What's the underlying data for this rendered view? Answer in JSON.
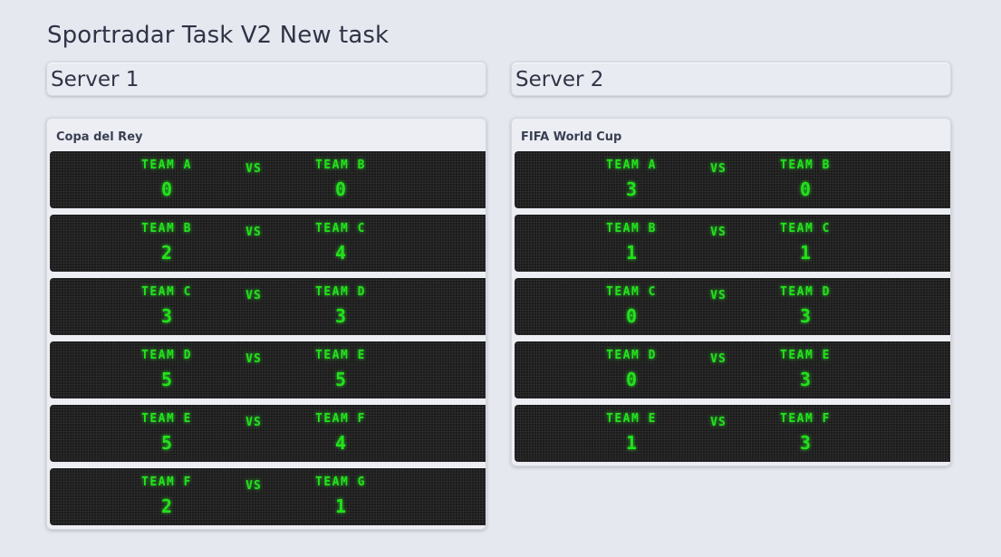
{
  "page_title": "Sportradar Task V2 New task",
  "vs_label": "VS",
  "servers": [
    {
      "name": "Server 1",
      "tournament": "Copa del Rey",
      "matches": [
        {
          "home": "TEAM A",
          "away": "TEAM B",
          "home_score": "0",
          "away_score": "0"
        },
        {
          "home": "TEAM B",
          "away": "TEAM C",
          "home_score": "2",
          "away_score": "4"
        },
        {
          "home": "TEAM C",
          "away": "TEAM D",
          "home_score": "3",
          "away_score": "3"
        },
        {
          "home": "TEAM D",
          "away": "TEAM E",
          "home_score": "5",
          "away_score": "5"
        },
        {
          "home": "TEAM E",
          "away": "TEAM F",
          "home_score": "5",
          "away_score": "4"
        },
        {
          "home": "TEAM F",
          "away": "TEAM G",
          "home_score": "2",
          "away_score": "1"
        }
      ]
    },
    {
      "name": "Server 2",
      "tournament": "FIFA World Cup",
      "matches": [
        {
          "home": "TEAM A",
          "away": "TEAM B",
          "home_score": "3",
          "away_score": "0"
        },
        {
          "home": "TEAM B",
          "away": "TEAM C",
          "home_score": "1",
          "away_score": "1"
        },
        {
          "home": "TEAM C",
          "away": "TEAM D",
          "home_score": "0",
          "away_score": "3"
        },
        {
          "home": "TEAM D",
          "away": "TEAM E",
          "home_score": "0",
          "away_score": "3"
        },
        {
          "home": "TEAM E",
          "away": "TEAM F",
          "home_score": "1",
          "away_score": "3"
        }
      ]
    }
  ],
  "colors": {
    "background": "#e6e8f0",
    "scoreboard": "#1b1b1b",
    "led_green": "#22e31a"
  }
}
